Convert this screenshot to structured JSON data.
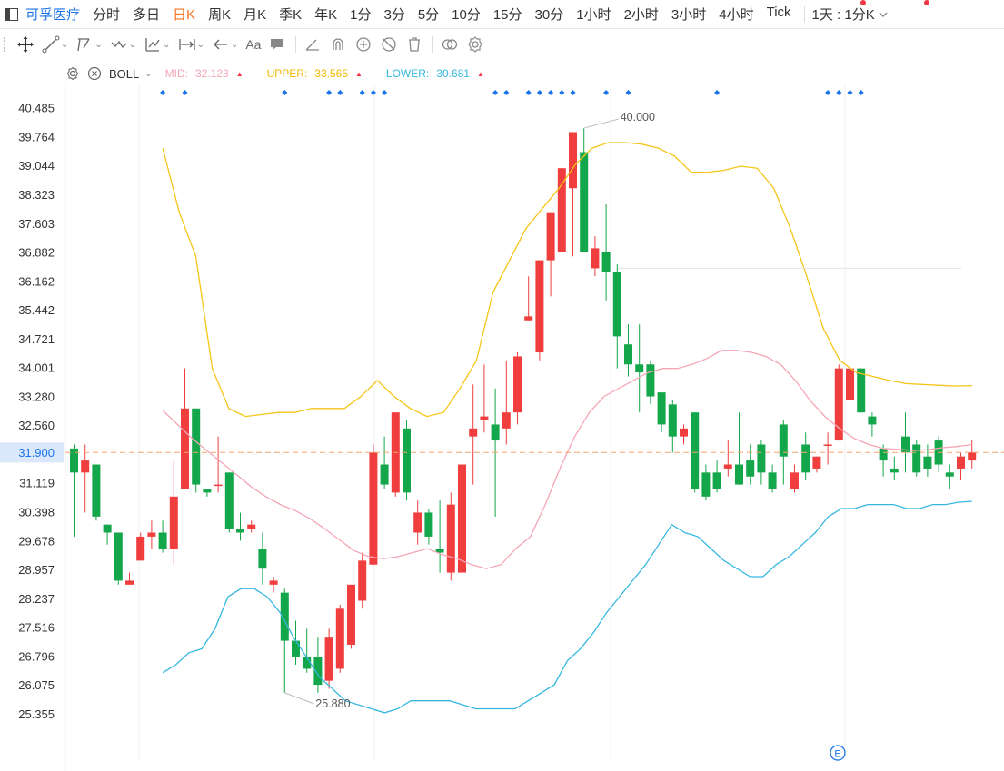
{
  "toolbar": {
    "stock_name": "可孚医疗",
    "timeframes": [
      "分时",
      "多日",
      "日K",
      "周K",
      "月K",
      "季K",
      "年K",
      "1分",
      "3分",
      "5分",
      "10分",
      "15分",
      "30分",
      "1小时",
      "2小时",
      "3小时",
      "4小时",
      "Tick"
    ],
    "active_timeframe": "日K",
    "period_select": "1天 : 1分K"
  },
  "drawing_tools": [
    "crosshair-icon",
    "line-icon",
    "channel-icon",
    "path-icon",
    "fib-icon",
    "range-icon",
    "arrow-icon",
    "text-icon",
    "note-icon",
    "angle-icon",
    "magnet-icon",
    "lock-icon",
    "hide-icon",
    "delete-icon",
    "compare-icon",
    "settings-icon"
  ],
  "drawing_text_tool": "Aa",
  "indicator": {
    "name": "BOLL",
    "mid_label": "MID:",
    "mid_value": "32.123",
    "upper_label": "UPPER:",
    "upper_value": "33.565",
    "lower_label": "LOWER:",
    "lower_value": "30.681",
    "colors": {
      "mid": "#f4a6b5",
      "upper": "#f5c518",
      "lower": "#36b8e0"
    }
  },
  "colors": {
    "up": "#f03e3e",
    "down": "#13a64a",
    "accent": "#1a73e8",
    "active": "#f5741d",
    "last_price": "#1a73e8"
  },
  "chart_data": {
    "type": "candlestick",
    "y_ticks": [
      "40.485",
      "39.764",
      "39.044",
      "38.323",
      "37.603",
      "36.882",
      "36.162",
      "35.442",
      "34.721",
      "34.001",
      "33.280",
      "32.560",
      "31.900",
      "31.119",
      "30.398",
      "29.678",
      "28.957",
      "28.237",
      "27.516",
      "26.796",
      "26.075",
      "25.355"
    ],
    "ylim": [
      24.9,
      40.75
    ],
    "last_price": "31.900",
    "high_annotation": "40.000",
    "low_annotation": "25.880",
    "candles": [
      {
        "o": 32.0,
        "h": 32.1,
        "c": 31.4,
        "l": 29.8
      },
      {
        "o": 31.4,
        "h": 32.1,
        "c": 31.7,
        "l": 30.4
      },
      {
        "o": 31.6,
        "h": 31.6,
        "c": 30.3,
        "l": 30.2
      },
      {
        "o": 30.1,
        "h": 30.1,
        "c": 29.9,
        "l": 29.6
      },
      {
        "o": 29.9,
        "h": 29.9,
        "c": 28.7,
        "l": 28.6
      },
      {
        "o": 28.6,
        "h": 28.9,
        "c": 28.7,
        "l": 28.6
      },
      {
        "o": 29.2,
        "h": 29.9,
        "c": 29.8,
        "l": 29.2
      },
      {
        "o": 29.8,
        "h": 30.2,
        "c": 29.9,
        "l": 29.5
      },
      {
        "o": 29.9,
        "h": 30.2,
        "c": 29.5,
        "l": 29.4
      },
      {
        "o": 29.5,
        "h": 31.7,
        "c": 30.8,
        "l": 29.1
      },
      {
        "o": 31.0,
        "h": 34.0,
        "c": 33.0,
        "l": 31.0
      },
      {
        "o": 33.0,
        "h": 33.0,
        "c": 31.1,
        "l": 30.9
      },
      {
        "o": 31.0,
        "h": 31.0,
        "c": 30.9,
        "l": 30.8
      },
      {
        "o": 31.1,
        "h": 32.3,
        "c": 31.1,
        "l": 30.9
      },
      {
        "o": 31.4,
        "h": 31.4,
        "c": 30.0,
        "l": 29.9
      },
      {
        "o": 30.0,
        "h": 30.4,
        "c": 29.9,
        "l": 29.7
      },
      {
        "o": 30.0,
        "h": 30.2,
        "c": 30.1,
        "l": 29.9
      },
      {
        "o": 29.5,
        "h": 29.9,
        "c": 29.0,
        "l": 28.6
      },
      {
        "o": 28.6,
        "h": 28.8,
        "c": 28.7,
        "l": 28.4
      },
      {
        "o": 28.4,
        "h": 28.5,
        "c": 27.2,
        "l": 25.9
      },
      {
        "o": 27.2,
        "h": 27.7,
        "c": 26.8,
        "l": 26.6
      },
      {
        "o": 26.8,
        "h": 27.5,
        "c": 26.5,
        "l": 26.4
      },
      {
        "o": 26.8,
        "h": 27.3,
        "c": 26.1,
        "l": 25.9
      },
      {
        "o": 26.2,
        "h": 27.5,
        "c": 27.3,
        "l": 26.0
      },
      {
        "o": 26.5,
        "h": 28.1,
        "c": 28.0,
        "l": 26.4
      },
      {
        "o": 27.1,
        "h": 28.6,
        "c": 28.6,
        "l": 27.0
      },
      {
        "o": 28.2,
        "h": 29.4,
        "c": 29.2,
        "l": 28.0
      },
      {
        "o": 29.1,
        "h": 32.1,
        "c": 31.9,
        "l": 29.1
      },
      {
        "o": 31.6,
        "h": 32.3,
        "c": 31.1,
        "l": 31.0
      },
      {
        "o": 30.9,
        "h": 32.9,
        "c": 32.9,
        "l": 30.8
      },
      {
        "o": 32.5,
        "h": 32.7,
        "c": 30.9,
        "l": 30.7
      },
      {
        "o": 29.9,
        "h": 30.7,
        "c": 30.4,
        "l": 29.6
      },
      {
        "o": 30.4,
        "h": 30.5,
        "c": 29.8,
        "l": 29.6
      },
      {
        "o": 29.5,
        "h": 30.7,
        "c": 29.4,
        "l": 28.9
      },
      {
        "o": 28.9,
        "h": 30.9,
        "c": 30.6,
        "l": 28.7
      },
      {
        "o": 28.9,
        "h": 31.6,
        "c": 31.6,
        "l": 28.9
      },
      {
        "o": 32.3,
        "h": 33.6,
        "c": 32.5,
        "l": 31.1
      },
      {
        "o": 32.7,
        "h": 34.1,
        "c": 32.8,
        "l": 32.4
      },
      {
        "o": 32.6,
        "h": 33.5,
        "c": 32.2,
        "l": 30.3
      },
      {
        "o": 32.5,
        "h": 34.2,
        "c": 32.9,
        "l": 32.1
      },
      {
        "o": 32.9,
        "h": 34.4,
        "c": 34.3,
        "l": 32.6
      },
      {
        "o": 35.2,
        "h": 36.3,
        "c": 35.3,
        "l": 35.2
      },
      {
        "o": 34.4,
        "h": 36.3,
        "c": 36.7,
        "l": 34.2
      },
      {
        "o": 36.7,
        "h": 37.3,
        "c": 37.9,
        "l": 35.8
      },
      {
        "o": 36.9,
        "h": 36.9,
        "c": 39.0,
        "l": 36.9
      },
      {
        "o": 38.5,
        "h": 39.7,
        "c": 39.9,
        "l": 36.8
      },
      {
        "o": 39.4,
        "h": 40.0,
        "c": 36.9,
        "l": 36.9
      },
      {
        "o": 36.5,
        "h": 37.3,
        "c": 37.0,
        "l": 36.3
      },
      {
        "o": 36.9,
        "h": 38.1,
        "c": 36.4,
        "l": 35.7
      },
      {
        "o": 36.4,
        "h": 36.6,
        "c": 34.8,
        "l": 34.0
      },
      {
        "o": 34.6,
        "h": 35.1,
        "c": 34.1,
        "l": 33.8
      },
      {
        "o": 34.1,
        "h": 35.1,
        "c": 33.9,
        "l": 32.9
      },
      {
        "o": 34.1,
        "h": 34.2,
        "c": 33.3,
        "l": 33.1
      },
      {
        "o": 33.4,
        "h": 33.4,
        "c": 32.6,
        "l": 32.4
      },
      {
        "o": 33.1,
        "h": 33.2,
        "c": 32.3,
        "l": 31.9
      },
      {
        "o": 32.3,
        "h": 32.6,
        "c": 32.5,
        "l": 32.1
      },
      {
        "o": 32.9,
        "h": 32.9,
        "c": 31.0,
        "l": 30.9
      },
      {
        "o": 31.4,
        "h": 31.6,
        "c": 30.8,
        "l": 30.7
      },
      {
        "o": 31.4,
        "h": 31.7,
        "c": 31.0,
        "l": 30.9
      },
      {
        "o": 31.5,
        "h": 32.2,
        "c": 31.6,
        "l": 31.3
      },
      {
        "o": 31.6,
        "h": 32.9,
        "c": 31.1,
        "l": 31.1
      },
      {
        "o": 31.7,
        "h": 32.1,
        "c": 31.3,
        "l": 31.1
      },
      {
        "o": 32.1,
        "h": 32.2,
        "c": 31.4,
        "l": 31.1
      },
      {
        "o": 31.4,
        "h": 31.6,
        "c": 31.0,
        "l": 30.9
      },
      {
        "o": 32.6,
        "h": 32.7,
        "c": 31.8,
        "l": 31.1
      },
      {
        "o": 31.0,
        "h": 31.6,
        "c": 31.4,
        "l": 30.9
      },
      {
        "o": 32.1,
        "h": 32.4,
        "c": 31.4,
        "l": 31.2
      },
      {
        "o": 31.5,
        "h": 31.8,
        "c": 31.8,
        "l": 31.4
      },
      {
        "o": 32.1,
        "h": 32.4,
        "c": 32.1,
        "l": 31.6
      },
      {
        "o": 32.2,
        "h": 34.1,
        "c": 34.0,
        "l": 32.2
      },
      {
        "o": 33.2,
        "h": 34.1,
        "c": 34.0,
        "l": 32.9
      },
      {
        "o": 34.0,
        "h": 34.0,
        "c": 32.9,
        "l": 32.9
      },
      {
        "o": 32.8,
        "h": 32.9,
        "c": 32.6,
        "l": 32.3
      },
      {
        "o": 32.0,
        "h": 32.1,
        "c": 31.7,
        "l": 31.3
      },
      {
        "o": 31.5,
        "h": 31.8,
        "c": 31.4,
        "l": 31.2
      },
      {
        "o": 32.3,
        "h": 32.9,
        "c": 31.9,
        "l": 31.4
      },
      {
        "o": 32.1,
        "h": 32.2,
        "c": 31.4,
        "l": 31.3
      },
      {
        "o": 31.8,
        "h": 32.1,
        "c": 31.5,
        "l": 31.3
      },
      {
        "o": 32.2,
        "h": 32.3,
        "c": 31.6,
        "l": 31.4
      },
      {
        "o": 31.4,
        "h": 31.6,
        "c": 31.3,
        "l": 31.0
      },
      {
        "o": 31.5,
        "h": 31.9,
        "c": 31.8,
        "l": 31.2
      },
      {
        "o": 31.7,
        "h": 32.2,
        "c": 31.9,
        "l": 31.5
      }
    ],
    "boll_mid": [
      32.95,
      32.6,
      32.25,
      31.95,
      31.65,
      31.35,
      31.05,
      30.8,
      30.6,
      30.45,
      30.25,
      30.0,
      29.72,
      29.45,
      29.3,
      29.25,
      29.3,
      29.4,
      29.5,
      29.35,
      29.25,
      29.1,
      29.0,
      29.1,
      29.5,
      29.8,
      30.6,
      31.5,
      32.3,
      32.9,
      33.3,
      33.5,
      33.7,
      33.9,
      34.0,
      34.0,
      34.1,
      34.25,
      34.45,
      34.45,
      34.4,
      34.3,
      34.1,
      33.7,
      33.2,
      32.8,
      32.5,
      32.25,
      32.1,
      32.0,
      31.98,
      31.95,
      31.97,
      32.02,
      32.05,
      32.1
    ],
    "boll_upper": [
      39.5,
      37.9,
      36.8,
      34.0,
      33.0,
      32.8,
      32.85,
      32.9,
      32.9,
      33.0,
      33.0,
      33.0,
      33.3,
      33.7,
      33.3,
      33.0,
      32.8,
      32.9,
      33.5,
      34.2,
      35.9,
      36.7,
      37.5,
      38.0,
      38.5,
      39.1,
      39.5,
      39.64,
      39.64,
      39.6,
      39.5,
      39.3,
      38.9,
      38.9,
      38.95,
      39.05,
      39.0,
      38.5,
      37.5,
      36.3,
      35.0,
      34.2,
      33.9,
      33.8,
      33.7,
      33.62,
      33.6,
      33.58,
      33.56,
      33.57
    ],
    "boll_lower": [
      26.4,
      26.6,
      26.9,
      27.0,
      27.5,
      28.3,
      28.5,
      28.5,
      28.3,
      27.9,
      27.3,
      26.8,
      26.3,
      26.0,
      25.7,
      25.6,
      25.5,
      25.4,
      25.5,
      25.7,
      25.7,
      25.7,
      25.7,
      25.6,
      25.5,
      25.5,
      25.5,
      25.5,
      25.7,
      25.9,
      26.1,
      26.7,
      27.0,
      27.4,
      27.9,
      28.3,
      28.7,
      29.1,
      29.6,
      30.1,
      29.9,
      29.8,
      29.5,
      29.2,
      29.0,
      28.8,
      28.8,
      29.1,
      29.3,
      29.6,
      29.9,
      30.3,
      30.5,
      30.5,
      30.6,
      30.6,
      30.6,
      30.5,
      30.5,
      30.6,
      30.6,
      30.66,
      30.68
    ]
  }
}
